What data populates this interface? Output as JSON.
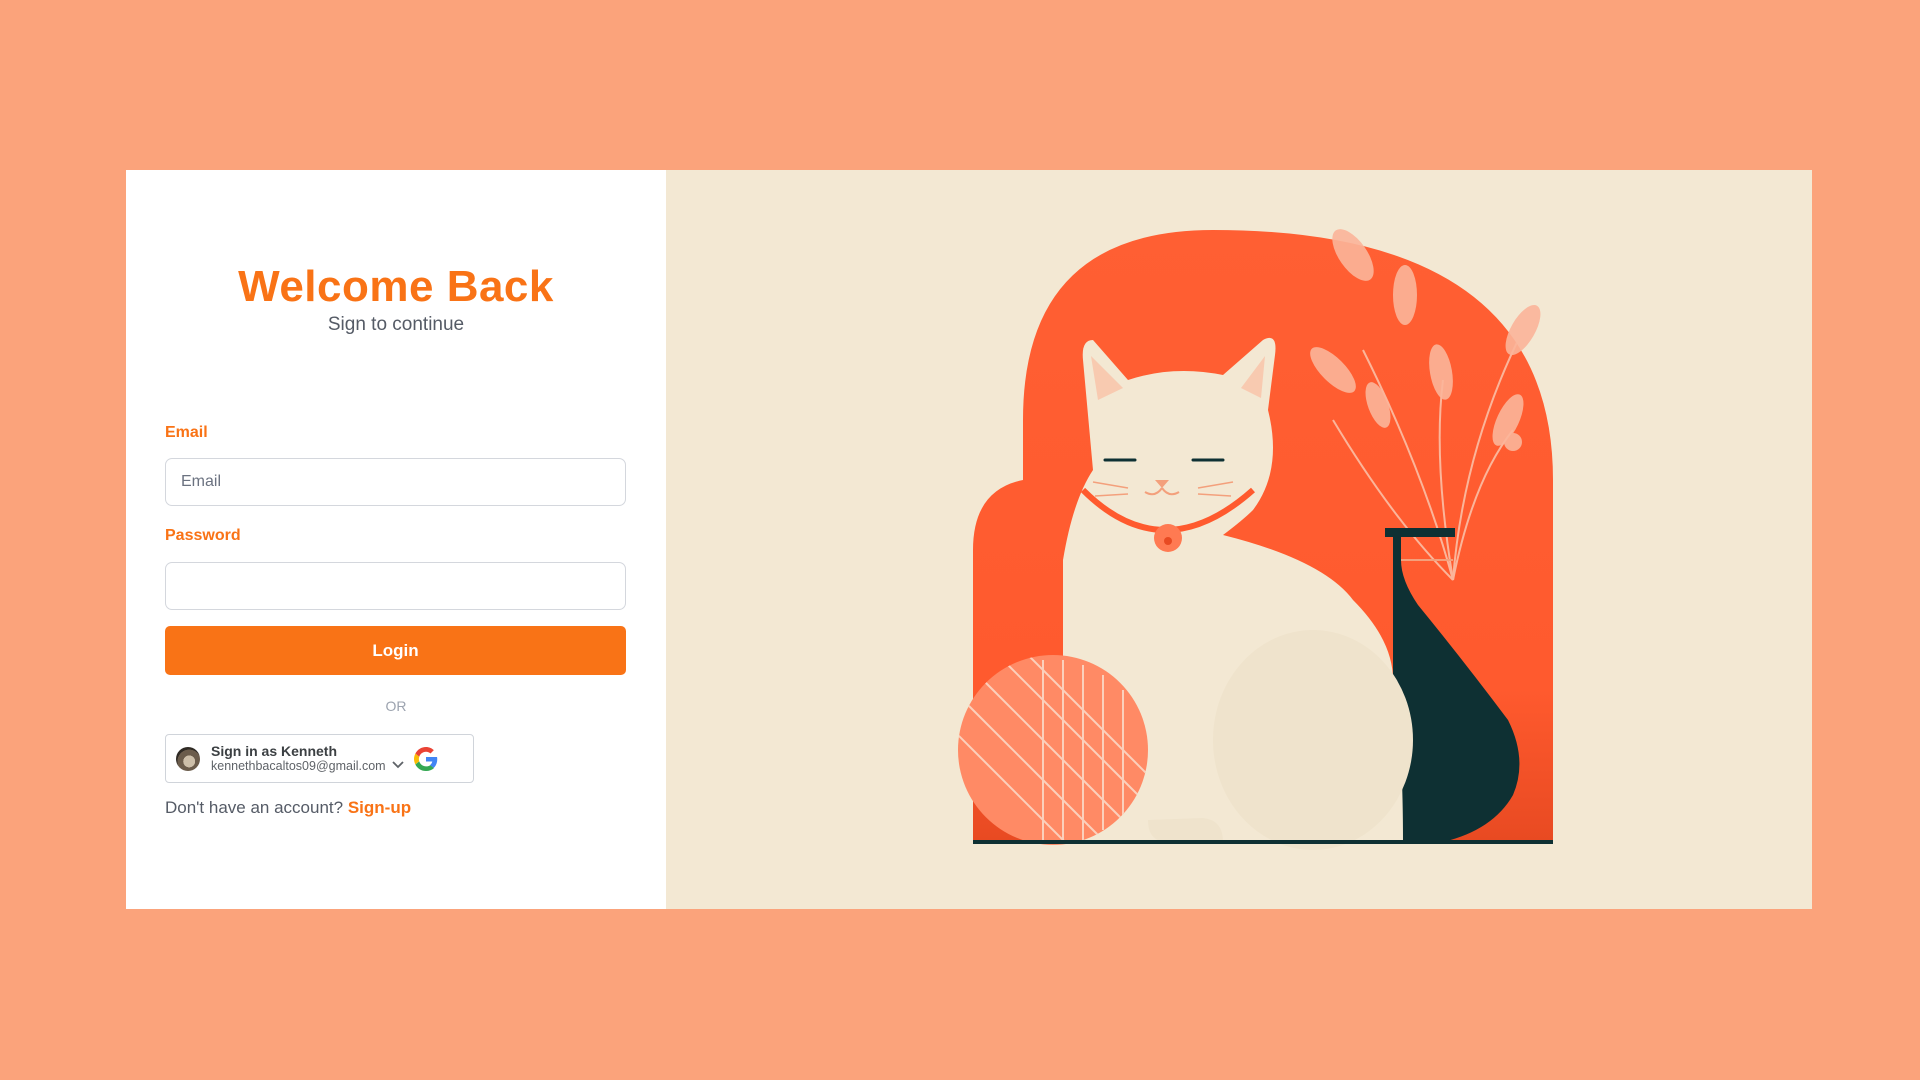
{
  "login": {
    "title": "Welcome Back",
    "subtitle": "Sign to continue",
    "email_label": "Email",
    "email_placeholder": "Email",
    "email_value": "",
    "password_label": "Password",
    "password_value": "",
    "login_button": "Login",
    "or_text": "OR",
    "google": {
      "name_line": "Sign in as Kenneth",
      "email": "kennethbacaltos09@gmail.com",
      "icon": "google-icon"
    },
    "no_account_text": "Don't have an account?",
    "signup_link": "Sign-up"
  },
  "colors": {
    "page_background": "#FBA37B",
    "accent": "#F97316",
    "illustration_background": "#F3E8D3",
    "arch": "#FF5A2E",
    "vase": "#0E3033"
  }
}
